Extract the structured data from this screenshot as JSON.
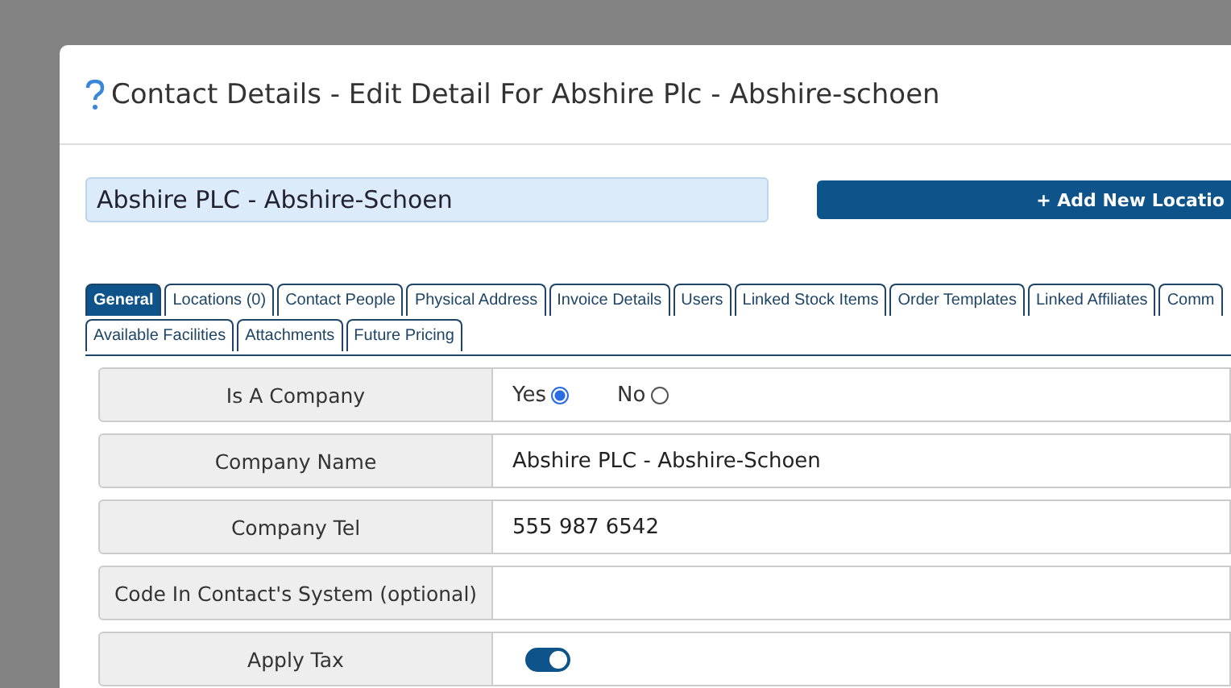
{
  "dialog": {
    "title": "Contact Details - Edit Detail For Abshire Plc - Abshire-schoen"
  },
  "name_field": {
    "value": "Abshire PLC - Abshire-Schoen"
  },
  "add_button": {
    "label": "+ Add New Locatio"
  },
  "tabs": [
    [
      {
        "label": "General",
        "selected": true
      },
      {
        "label": "Locations (0)",
        "selected": false
      },
      {
        "label": "Contact People",
        "selected": false
      },
      {
        "label": "Physical Address",
        "selected": false
      },
      {
        "label": "Invoice Details",
        "selected": false
      },
      {
        "label": "Users",
        "selected": false
      },
      {
        "label": "Linked Stock Items",
        "selected": false
      },
      {
        "label": "Order Templates",
        "selected": false
      },
      {
        "label": "Linked Affiliates",
        "selected": false
      },
      {
        "label": "Comm",
        "selected": false
      }
    ],
    [
      {
        "label": "Available Facilities",
        "selected": false
      },
      {
        "label": "Attachments",
        "selected": false
      },
      {
        "label": "Future Pricing",
        "selected": false
      }
    ]
  ],
  "fields": [
    {
      "kind": "radio",
      "label": "Is A Company",
      "options": [
        {
          "label": "Yes",
          "selected": true
        },
        {
          "label": "No",
          "selected": false
        }
      ]
    },
    {
      "kind": "text",
      "label": "Company Name",
      "value": "Abshire PLC - Abshire-Schoen"
    },
    {
      "kind": "text",
      "label": "Company Tel",
      "value": "555 987 6542"
    },
    {
      "kind": "text",
      "label": "Code In Contact's System (optional)"
    },
    {
      "kind": "toggle",
      "label": "Apply Tax",
      "on": true
    }
  ]
}
